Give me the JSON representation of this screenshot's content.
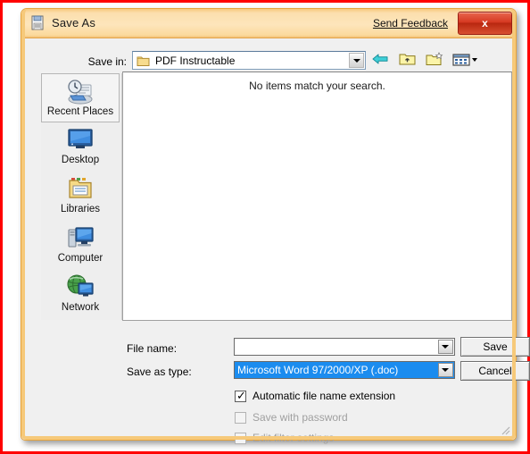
{
  "window": {
    "title": "Save As",
    "title_icon": "save-document-icon",
    "feedback_link": "Send Feedback",
    "close_label": "x"
  },
  "savein": {
    "label": "Save in:",
    "value": "PDF Instructable",
    "folder_icon": "folder-icon",
    "dropdown_icon": "chevron-down-icon"
  },
  "toolbar": {
    "buttons": [
      {
        "name": "back-arrow-icon",
        "tooltip": "Back"
      },
      {
        "name": "up-folder-icon",
        "tooltip": "Up One Level"
      },
      {
        "name": "new-folder-icon",
        "tooltip": "Create New Folder"
      },
      {
        "name": "view-menu-icon",
        "tooltip": "Views"
      }
    ]
  },
  "places": [
    {
      "label": "Recent Places",
      "icon": "recent-places-icon",
      "selected": true
    },
    {
      "label": "Desktop",
      "icon": "desktop-icon",
      "selected": false
    },
    {
      "label": "Libraries",
      "icon": "libraries-folder-icon",
      "selected": false
    },
    {
      "label": "Computer",
      "icon": "computer-icon",
      "selected": false
    },
    {
      "label": "Network",
      "icon": "network-globe-icon",
      "selected": false
    }
  ],
  "filelist": {
    "empty_message": "No items match your search.",
    "items": []
  },
  "form": {
    "filename_label": "File name:",
    "filename_value": "",
    "filename_placeholder": "",
    "savetype_label": "Save as type:",
    "savetype_value": "Microsoft Word 97/2000/XP (.doc)",
    "save_button": "Save",
    "cancel_button": "Cancel"
  },
  "checkboxes": [
    {
      "label": "Automatic file name extension",
      "checked": true,
      "enabled": true
    },
    {
      "label": "Save with password",
      "checked": false,
      "enabled": false
    },
    {
      "label": "Edit filter settings",
      "checked": false,
      "enabled": false
    }
  ],
  "colors": {
    "titlebar_start": "#f7c87c",
    "titlebar_end": "#fbd99c",
    "dialog_border": "#f6c97a",
    "close_button": "#c62e14",
    "selection_blue": "#1b8cef",
    "annotation_red": "#ff0000",
    "dialog_background": "#f0f0f0"
  }
}
